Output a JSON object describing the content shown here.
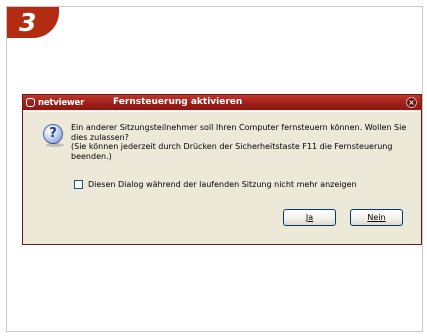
{
  "step_badge": "3",
  "dialog": {
    "brand": "netviewer",
    "title": "Fernsteuerung aktivieren",
    "close_glyph": "×",
    "message_line1": "Ein anderer Sitzungsteilnehmer soll Ihren Computer fernsteuern können. Wollen Sie dies zulassen?",
    "message_line2": "(Sie können jederzeit durch Drücken der Sicherheitstaste F11 die Fernsteuerung beenden.)",
    "checkbox_label": "Diesen Dialog während der laufenden Sitzung nicht mehr anzeigen",
    "checkbox_checked": false,
    "yes_label": "Ja",
    "no_label": "Nein",
    "icon": "question-icon"
  },
  "colors": {
    "titlebar": "#9e1f1a",
    "badge": "#b32c12",
    "dialog_bg": "#ece9d8"
  }
}
